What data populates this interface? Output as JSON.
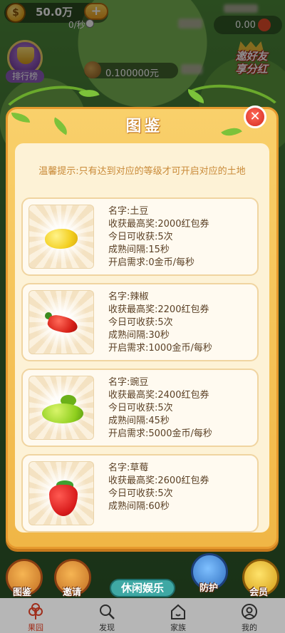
{
  "status": {
    "coin_symbol": "$",
    "coins": "50.0万",
    "add_label": "+",
    "rate": "0/秒",
    "cash": "0.00"
  },
  "leaderboard": {
    "label": "排行榜"
  },
  "money": {
    "value": "0.100000元"
  },
  "invite_promo": {
    "line1": "邀好友",
    "line2": "享分红"
  },
  "modal": {
    "title": "图鉴",
    "close_label": "✕",
    "tip": "温馨提示:只有达到对应的等级才可开启对应的土地",
    "cards": [
      {
        "icon": "potato-icon",
        "name": "名字:土豆",
        "max_reward": "收获最高奖:2000红包券",
        "daily": "今日可收获:5次",
        "interval": "成熟间隔:15秒",
        "unlock": "开启需求:0金币/每秒"
      },
      {
        "icon": "chili-pepper-icon",
        "name": "名字:辣椒",
        "max_reward": "收获最高奖:2200红包券",
        "daily": "今日可收获:5次",
        "interval": "成熟间隔:30秒",
        "unlock": "开启需求:1000金币/每秒"
      },
      {
        "icon": "pea-icon",
        "name": "名字:豌豆",
        "max_reward": "收获最高奖:2400红包券",
        "daily": "今日可收获:5次",
        "interval": "成熟间隔:45秒",
        "unlock": "开启需求:5000金币/每秒"
      },
      {
        "icon": "strawberry-icon",
        "name": "名字:草莓",
        "max_reward": "收获最高奖:2600红包券",
        "daily": "今日可收获:5次",
        "interval": "成熟间隔:60秒",
        "unlock": ""
      }
    ]
  },
  "bottom_buttons": {
    "handbook": "图鉴",
    "invite": "邀请",
    "leisure": "休闲娱乐",
    "protect": "防护",
    "member": "会员"
  },
  "tabs": [
    {
      "label": "果园",
      "icon": "orchard-icon",
      "active": true
    },
    {
      "label": "发现",
      "icon": "search-icon",
      "active": false
    },
    {
      "label": "家族",
      "icon": "home-icon",
      "active": false
    },
    {
      "label": "我的",
      "icon": "profile-icon",
      "active": false
    }
  ],
  "colors": {
    "panel": "#f0b646",
    "inner": "#fdf2d6",
    "tip_text": "#c98a38",
    "card_text": "#5a4025",
    "close_button": "#d3281d",
    "active_tab": "#a02e1b"
  }
}
